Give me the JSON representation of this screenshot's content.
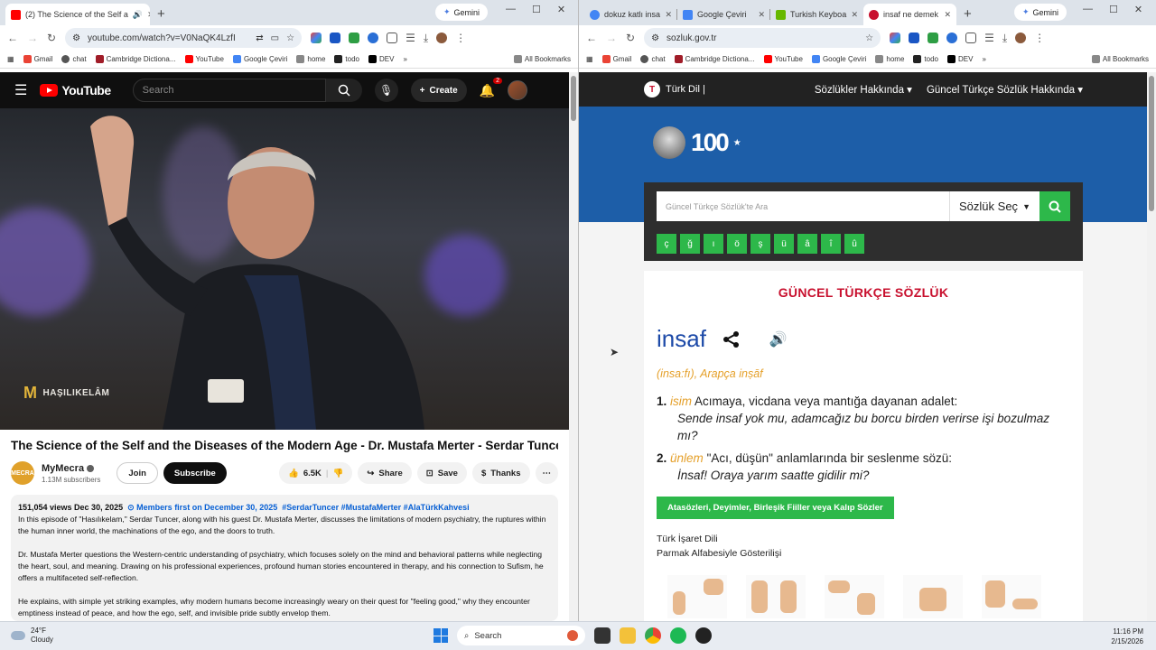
{
  "left_browser": {
    "tabs": [
      {
        "title": "(2) The Science of the Self a"
      }
    ],
    "gemini_label": "Gemini",
    "url": "youtube.com/watch?v=V0NaQK4LzfI",
    "bookmarks": [
      "Gmail",
      "chat",
      "Cambridge Dictiona...",
      "YouTube",
      "Google Çeviri",
      "home",
      "todo",
      "DEV"
    ],
    "all_bookmarks": "All Bookmarks"
  },
  "youtube": {
    "logo_text": "YouTube",
    "search_placeholder": "Search",
    "create_label": "Create",
    "notification_count": "2",
    "watermark": "HAŞILIKELÂM",
    "video_title": "The Science of the Self and the Diseases of the Modern Age - Dr. Mustafa Merter - Serdar Tuncer |...",
    "channel": {
      "avatar_text": "MECRA",
      "name": "MyMecra",
      "subscribers": "1.13M subscribers"
    },
    "join_label": "Join",
    "subscribe_label": "Subscribe",
    "likes": "6.5K",
    "share_label": "Share",
    "save_label": "Save",
    "thanks_label": "Thanks",
    "description": {
      "views_date": "151,054 views  Dec 30, 2025",
      "members_first": "Members first on December 30, 2025",
      "hashtags": "#SerdarTuncer #MustafaMerter #AlaTürkKahvesi",
      "p1": "In this episode of \"Hasılıkelam,\" Serdar Tuncer, along with his guest Dr. Mustafa Merter, discusses the limitations of modern psychiatry, the ruptures within the human inner world, the machinations of the ego, and the doors to truth.",
      "p2": "Dr. Mustafa Merter questions the Western-centric understanding of psychiatry, which focuses solely on the mind and behavioral patterns while neglecting the heart, soul, and meaning. Drawing on his professional experiences, profound human stories encountered in therapy, and his connection to Sufism, he offers a multifaceted self-reflection.",
      "p3": "He explains, with simple yet striking examples, why modern humans become increasingly weary on their quest for \"feeling good,\" why they encounter emptiness instead of peace, and how the ego, self, and invisible pride subtly envelop them."
    }
  },
  "right_browser": {
    "tabs": [
      {
        "title": "dokuz katlı insa"
      },
      {
        "title": "Google Çeviri"
      },
      {
        "title": "Turkish Keyboa"
      },
      {
        "title": "insaf ne demek"
      }
    ],
    "gemini_label": "Gemini",
    "url": "sozluk.gov.tr",
    "bookmarks": [
      "Gmail",
      "chat",
      "Cambridge Dictiona...",
      "YouTube",
      "Google Çeviri",
      "home",
      "todo",
      "DEV"
    ],
    "all_bookmarks": "All Bookmarks"
  },
  "tdk": {
    "brand": "Türk Dil |",
    "menu": [
      "Sözlükler Hakkında",
      "Güncel Türkçe Sözlük Hakkında"
    ],
    "centenary": "100",
    "search_placeholder": "Güncel Türkçe Sözlük'te Ara",
    "dict_select": "Sözlük Seç",
    "special_chars": [
      "ç",
      "ğ",
      "ı",
      "ö",
      "ş",
      "ü",
      "â",
      "î",
      "û"
    ],
    "section_title": "GÜNCEL TÜRKÇE SÖZLÜK",
    "headword": "insaf",
    "origin": "(insa:fı), Arapça inṣāf",
    "senses": [
      {
        "num": "1.",
        "pos": "isim",
        "definition": "Acımaya, vicdana veya mantığa dayanan adalet:",
        "example": "Sende insaf yok mu, adamcağız bu borcu birden verirse işi bozulmaz mı?"
      },
      {
        "num": "2.",
        "pos": "ünlem",
        "definition": "\"Acı, düşün\" anlamlarında bir seslenme sözü:",
        "example": "İnsaf! Oraya yarım saatte gidilir mi?"
      }
    ],
    "idioms_button": "Atasözleri, Deyimler, Birleşik Fiiller veya Kalıp Sözler",
    "sign_language": "Türk İşaret Dili",
    "finger_alphabet": "Parmak Alfabesiyle Gösterilişi",
    "sign_letters": [
      "i",
      "n",
      "s",
      "a",
      "f"
    ]
  },
  "taskbar": {
    "temperature": "24°F",
    "condition": "Cloudy",
    "search_label": "Search",
    "time": "11:16 PM",
    "date": "2/15/2026"
  }
}
